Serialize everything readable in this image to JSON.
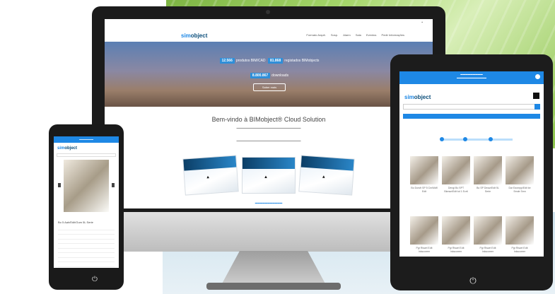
{
  "desktop": {
    "nav_logo_a": "sim",
    "nav_logo_b": "object",
    "menu": [
      "Formato Arquit.",
      "Sosp.",
      "Alarm",
      "Sala",
      "Eventos",
      "Pedir Informações"
    ],
    "hero_stats": [
      {
        "value": "12.566",
        "label": "produtos BIM/CAD"
      },
      {
        "value": "81.868",
        "label": "registados BIMobjects"
      }
    ],
    "hero_downloads": {
      "value": "8.800.867",
      "label": "downloads"
    },
    "hero_button": "Saber mais",
    "welcome_title": "Bem-vindo à BIMobject® Cloud Solution"
  },
  "tablet": {
    "logo_a": "sim",
    "logo_b": "object",
    "products": [
      {
        "name": "Bo Dorsfr SP 5 Cm/Mdfl Edit"
      },
      {
        "name": "Dengi Bo SPT Bkmaz/Edit kd 1 Ecrit"
      },
      {
        "name": "Bo SP Dmaz/Edit 5L Serie"
      },
      {
        "name": "Dar Eaxmpp/Edit ke Smde Smn"
      },
      {
        "name": "Pgr Riswrl Edit Inkscoreer"
      },
      {
        "name": "Pgr Riswrl Edit Inkscoreer"
      },
      {
        "name": "Pgr Riswrl Edit Inkscoreer"
      },
      {
        "name": "Pgr Riswrl Edit Inkscoreer"
      }
    ]
  },
  "phone": {
    "logo_a": "sim",
    "logo_b": "object",
    "title": "Bo 5 Aalr/Edit/Gum 5L Serie"
  },
  "colors": {
    "accent": "#1e88e5",
    "logo_dark": "#0a4d7a"
  }
}
